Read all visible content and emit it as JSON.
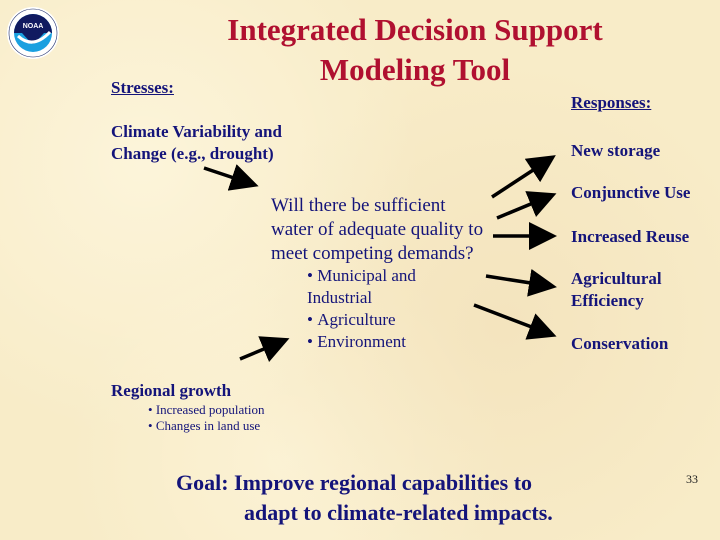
{
  "slide": {
    "title_line1": "Integrated Decision Support",
    "title_line2": "Modeling Tool",
    "logo_text": "NOAA",
    "stresses": {
      "heading": "Stresses:",
      "climate_line1": "Climate Variability and",
      "climate_line2": "Change (e.g., drought)",
      "regional_heading": "Regional growth",
      "regional_items": [
        "Increased population",
        "Changes in land use"
      ]
    },
    "question": {
      "line1": "Will there be sufficient",
      "line2": "water of adequate quality to",
      "line3": "meet competing demands?",
      "demands": [
        "Municipal and",
        "Industrial",
        "Agriculture",
        "Environment"
      ]
    },
    "responses": {
      "heading": "Responses:",
      "items": [
        "New storage",
        "Conjunctive Use",
        "Increased Reuse",
        "Agricultural",
        "Efficiency",
        "Conservation"
      ]
    },
    "goal": {
      "line1": "Goal:  Improve regional capabilities to",
      "line2": "adapt to climate-related impacts."
    },
    "page_number": "33",
    "colors": {
      "title": "#b01030",
      "text": "#14147a",
      "background": "#f8ecc8"
    }
  }
}
